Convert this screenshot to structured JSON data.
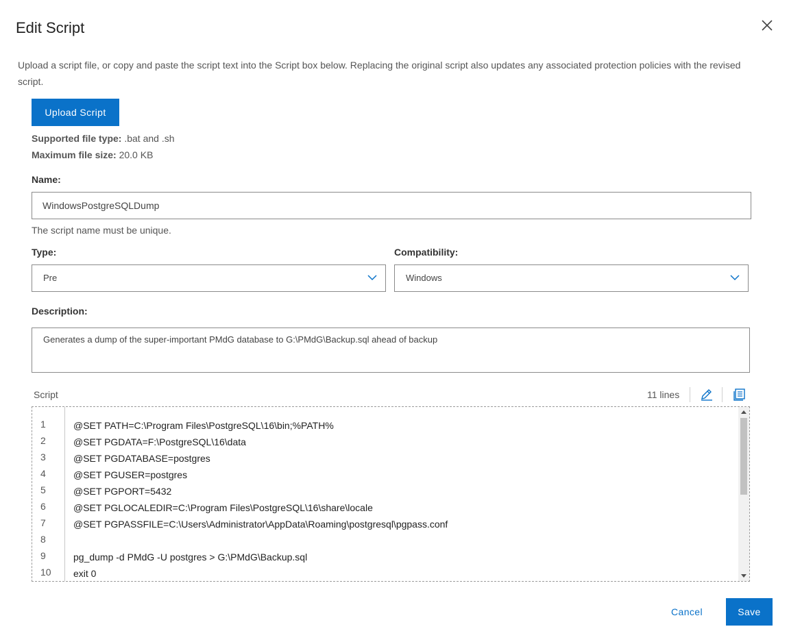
{
  "dialog": {
    "title": "Edit Script",
    "intro": "Upload a script file, or copy and paste the script text into the Script box below. Replacing the original script also updates any associated protection policies with the revised script."
  },
  "upload": {
    "button_label": "Upload Script",
    "supported_label": "Supported file type:",
    "supported_value": ".bat and .sh",
    "max_label": "Maximum file size:",
    "max_value": "20.0 KB"
  },
  "name": {
    "label": "Name:",
    "value": "WindowsPostgreSQLDump",
    "hint": "The script name must be unique."
  },
  "type": {
    "label": "Type:",
    "value": "Pre"
  },
  "compatibility": {
    "label": "Compatibility:",
    "value": "Windows"
  },
  "description": {
    "label": "Description:",
    "value": "Generates a dump of the super-important PMdG database to G:\\PMdG\\Backup.sql ahead of backup"
  },
  "script": {
    "label": "Script",
    "lines_count": "11 lines",
    "line_numbers": [
      "1",
      "2",
      "3",
      "4",
      "5",
      "6",
      "7",
      "8",
      "9",
      "10"
    ],
    "lines": [
      "@SET PATH=C:\\Program Files\\PostgreSQL\\16\\bin;%PATH%",
      "@SET PGDATA=F:\\PostgreSQL\\16\\data",
      "@SET PGDATABASE=postgres",
      "@SET PGUSER=postgres",
      "@SET PGPORT=5432",
      "@SET PGLOCALEDIR=C:\\Program Files\\PostgreSQL\\16\\share\\locale",
      "@SET PGPASSFILE=C:\\Users\\Administrator\\AppData\\Roaming\\postgresql\\pgpass.conf",
      "",
      "pg_dump -d PMdG -U postgres > G:\\PMdG\\Backup.sql",
      "exit 0"
    ]
  },
  "footer": {
    "cancel_label": "Cancel",
    "save_label": "Save"
  },
  "colors": {
    "accent": "#0a72c9",
    "border": "#8a8a8a"
  },
  "icons": {
    "close": "close-icon",
    "chevron": "chevron-down-icon",
    "edit": "pencil-icon",
    "copy": "copy-document-icon"
  }
}
